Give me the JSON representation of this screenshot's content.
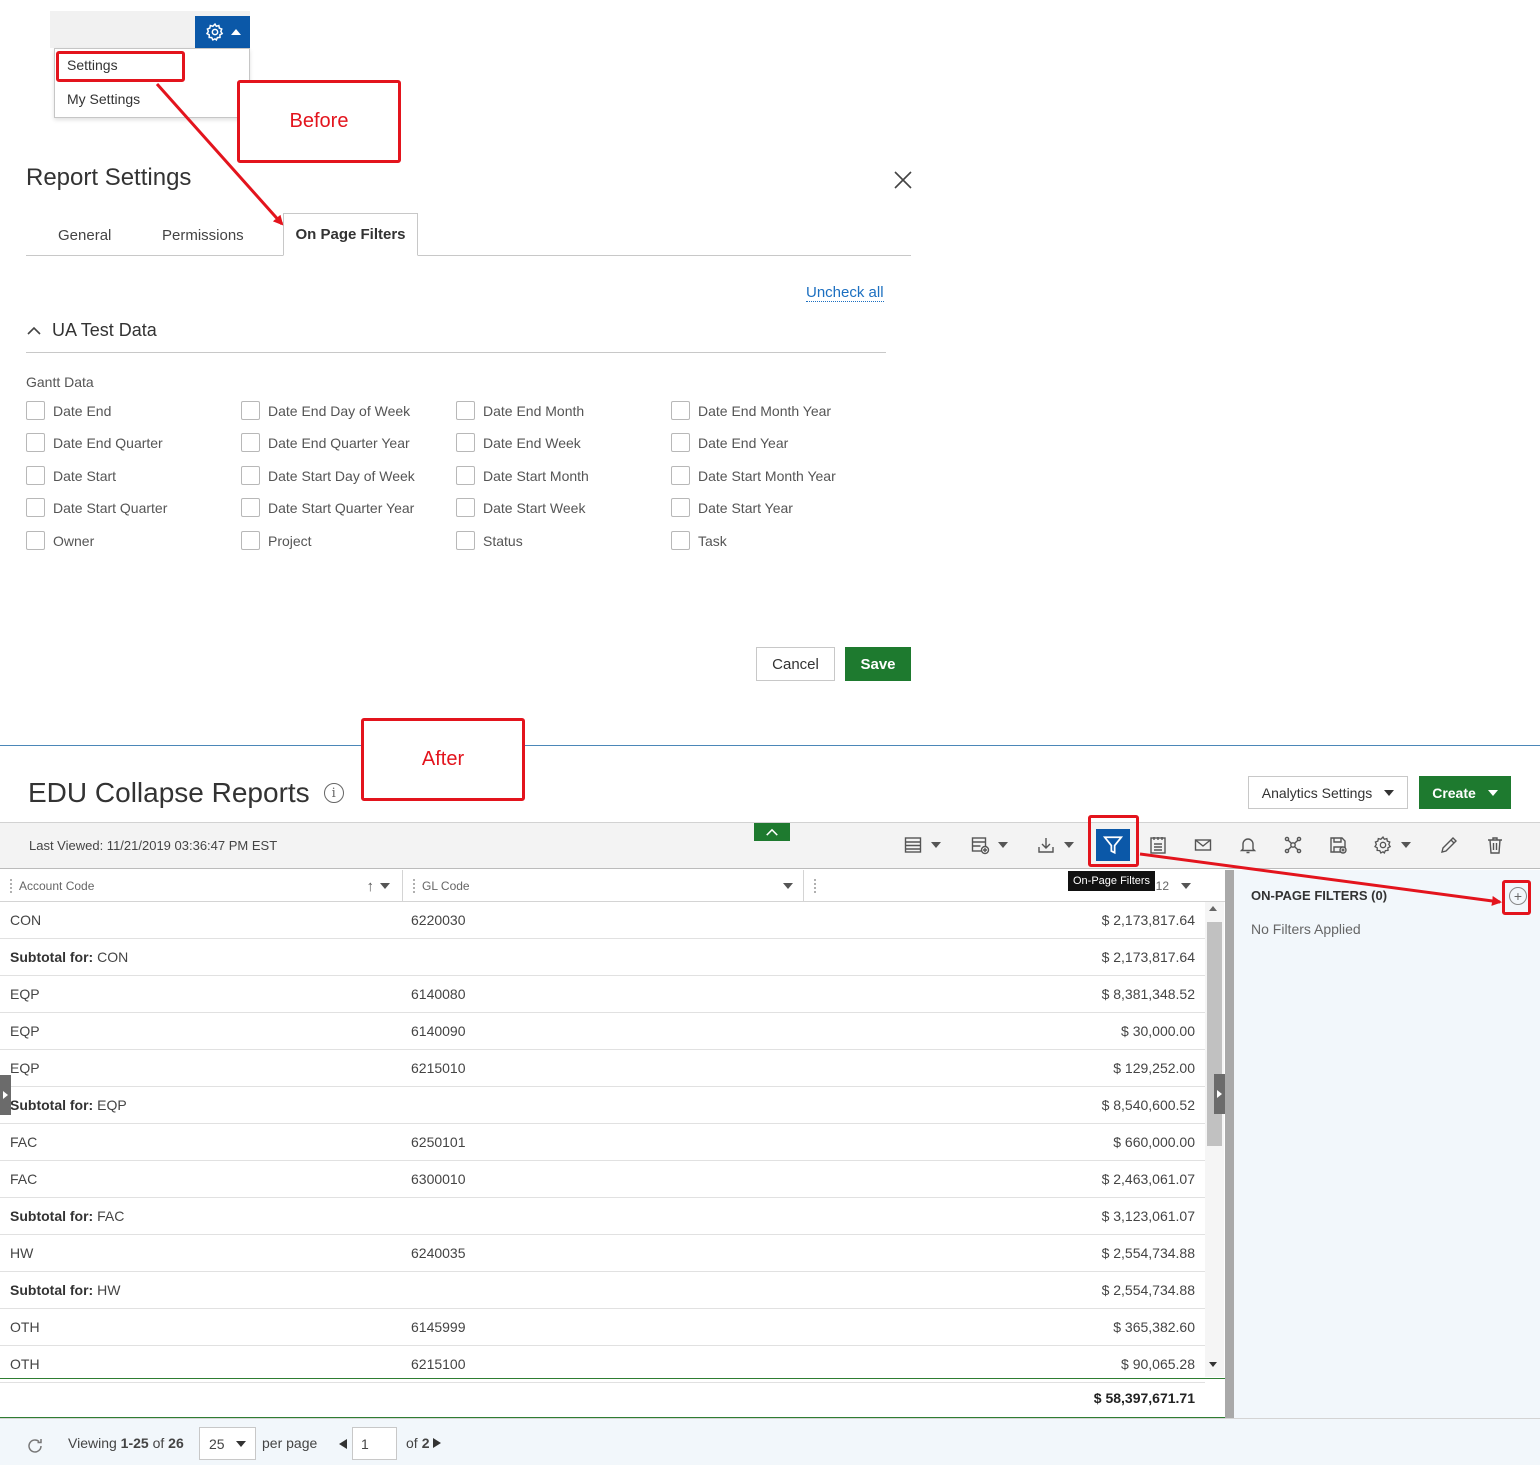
{
  "before_label": "Before",
  "after_label": "After",
  "gear_menu": {
    "items": [
      "Settings",
      "My Settings"
    ]
  },
  "report_settings": {
    "title": "Report Settings",
    "tabs": [
      "General",
      "Permissions",
      "On Page Filters"
    ],
    "active_tab": "On Page Filters",
    "uncheck_all": "Uncheck all",
    "section_title": "UA Test Data",
    "group_label": "Gantt Data",
    "checkboxes": [
      [
        "Date End",
        "Date End Day of Week",
        "Date End Month",
        "Date End Month Year"
      ],
      [
        "Date End Quarter",
        "Date End Quarter Year",
        "Date End Week",
        "Date End Year"
      ],
      [
        "Date Start",
        "Date Start Day of Week",
        "Date Start Month",
        "Date Start Month Year"
      ],
      [
        "Date Start Quarter",
        "Date Start Quarter Year",
        "Date Start Week",
        "Date Start Year"
      ],
      [
        "Owner",
        "Project",
        "Status",
        "Task"
      ]
    ],
    "cancel": "Cancel",
    "save": "Save"
  },
  "report": {
    "title": "EDU Collapse Reports",
    "analytics_settings": "Analytics Settings",
    "create": "Create",
    "last_viewed": "Last Viewed: 11/21/2019 03:36:47 PM EST",
    "tooltip": "On-Page Filters",
    "columns": [
      "Account Code",
      "GL Code",
      "12"
    ],
    "rows": [
      {
        "code": "CON",
        "gl": "6220030",
        "amount": "$ 2,173,817.64",
        "subtotal": false
      },
      {
        "code": "CON",
        "label": "Subtotal for:",
        "gl": "",
        "amount": "$ 2,173,817.64",
        "subtotal": true
      },
      {
        "code": "EQP",
        "gl": "6140080",
        "amount": "$ 8,381,348.52",
        "subtotal": false
      },
      {
        "code": "EQP",
        "gl": "6140090",
        "amount": "$ 30,000.00",
        "subtotal": false
      },
      {
        "code": "EQP",
        "gl": "6215010",
        "amount": "$ 129,252.00",
        "subtotal": false
      },
      {
        "code": "EQP",
        "label": "Subtotal for:",
        "gl": "",
        "amount": "$ 8,540,600.52",
        "subtotal": true
      },
      {
        "code": "FAC",
        "gl": "6250101",
        "amount": "$ 660,000.00",
        "subtotal": false
      },
      {
        "code": "FAC",
        "gl": "6300010",
        "amount": "$ 2,463,061.07",
        "subtotal": false
      },
      {
        "code": "FAC",
        "label": "Subtotal for:",
        "gl": "",
        "amount": "$ 3,123,061.07",
        "subtotal": true
      },
      {
        "code": "HW",
        "gl": "6240035",
        "amount": "$ 2,554,734.88",
        "subtotal": false
      },
      {
        "code": "HW",
        "label": "Subtotal for:",
        "gl": "",
        "amount": "$ 2,554,734.88",
        "subtotal": true
      },
      {
        "code": "OTH",
        "gl": "6145999",
        "amount": "$ 365,382.60",
        "subtotal": false
      },
      {
        "code": "OTH",
        "gl": "6215100",
        "amount": "$ 90,065.28",
        "subtotal": false
      }
    ],
    "grand_total": "$ 58,397,671.71",
    "filters_panel": {
      "title": "ON-PAGE FILTERS (0)",
      "empty": "No Filters Applied"
    },
    "footer": {
      "viewing_prefix": "Viewing",
      "viewing_range": "1-25",
      "viewing_of": "of",
      "viewing_total": "26",
      "per_page_value": "25",
      "per_page_label": "per page",
      "page_value": "1",
      "of_label": "of",
      "total_pages": "2"
    }
  },
  "colors": {
    "primary_blue": "#0b58a8",
    "green": "#1e7a2f",
    "annotation_red": "#e3141d",
    "link_blue": "#1c6fc0"
  }
}
